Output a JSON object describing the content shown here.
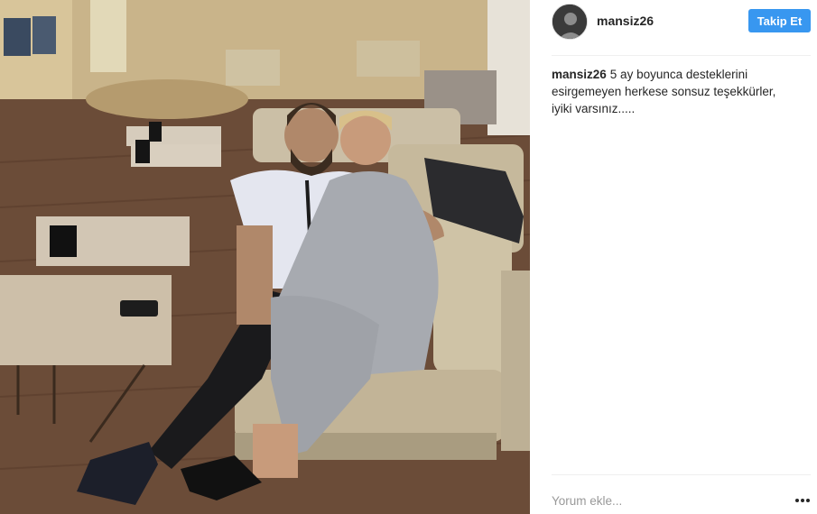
{
  "post": {
    "image": {
      "semantic": "photo of a couple sitting on a beige couch in a hotel lobby"
    }
  },
  "header": {
    "username": "mansiz26",
    "follow_label": "Takip Et",
    "avatar_icon": "user-avatar"
  },
  "caption": {
    "username": "mansiz26",
    "text": "5 ay boyunca desteklerini esirgemeyen herkese sonsuz teşekkürler, iyiki varsınız....."
  },
  "comment": {
    "placeholder": "Yorum ekle..."
  },
  "more_options_icon": "more-horizontal-icon",
  "colors": {
    "follow_button": "#3897f0",
    "text": "#262626",
    "placeholder": "#999999",
    "divider": "#efefef"
  }
}
